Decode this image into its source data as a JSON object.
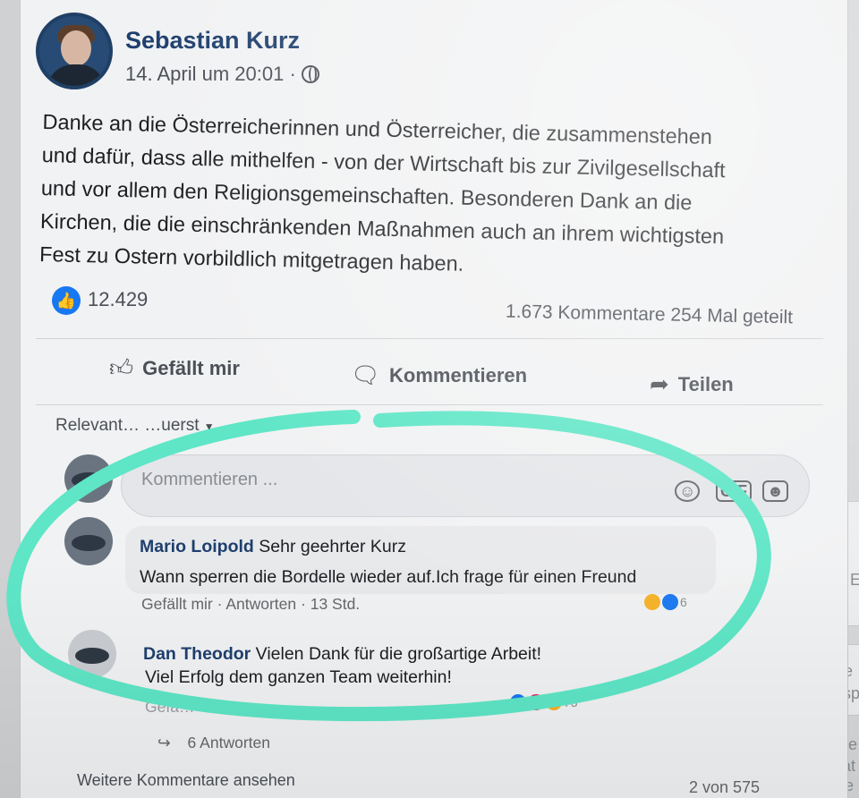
{
  "post": {
    "author": "Sebastian Kurz",
    "date": "14. April um 20:01 ·",
    "text_lines": [
      "Danke an die Österreicherinnen und Österreicher, die zusammenstehen",
      "und dafür, dass alle mithelfen - von der Wirtschaft bis zur Zivilgesellschaft",
      "und vor allem den Religionsgemeinschaften. Besonderen Dank an die",
      "Kirchen, die die einschränkenden Maßnahmen auch an ihrem wichtigsten",
      "Fest zu Ostern vorbildlich mitgetragen haben."
    ],
    "likes": "12.429",
    "stats": "1.673 Kommentare  254 Mal geteilt"
  },
  "actions": {
    "like": "Gefällt mir",
    "comment": "Kommentieren",
    "share": "Teilen"
  },
  "comments_section": {
    "sort": "Relevant… …uerst",
    "input_placeholder": "Kommentieren ...",
    "gif": "GIF",
    "comments": [
      {
        "name": "Mario Loipold",
        "line1": "Sehr geehrter Kurz",
        "line2": "Wann sperren die Bordelle wieder auf.Ich frage für einen Freund",
        "like": "Gefällt mir",
        "reply": "· Antworten",
        "time": "· 13 Std.",
        "reaction_count": "6"
      },
      {
        "name": "Dan Theodor",
        "line1": "Vielen Dank für die großartige Arbeit!",
        "line2": "Viel Erfolg dem ganzen Team weiterhin!",
        "meta": "Gefä…",
        "reaction_count": "73",
        "replies": "6 Antworten"
      }
    ],
    "more": "Weitere Kommentare ansehen",
    "pager": "2 von 575"
  },
  "rail": {
    "e": "E",
    "de": "De",
    "esp": "Esp",
    "date": "Date",
    "dat": "Dat",
    "face": "Face"
  },
  "colors": {
    "accent": "#1877f2",
    "name": "#1e3f6e",
    "highlight": "#5ee6c6"
  }
}
